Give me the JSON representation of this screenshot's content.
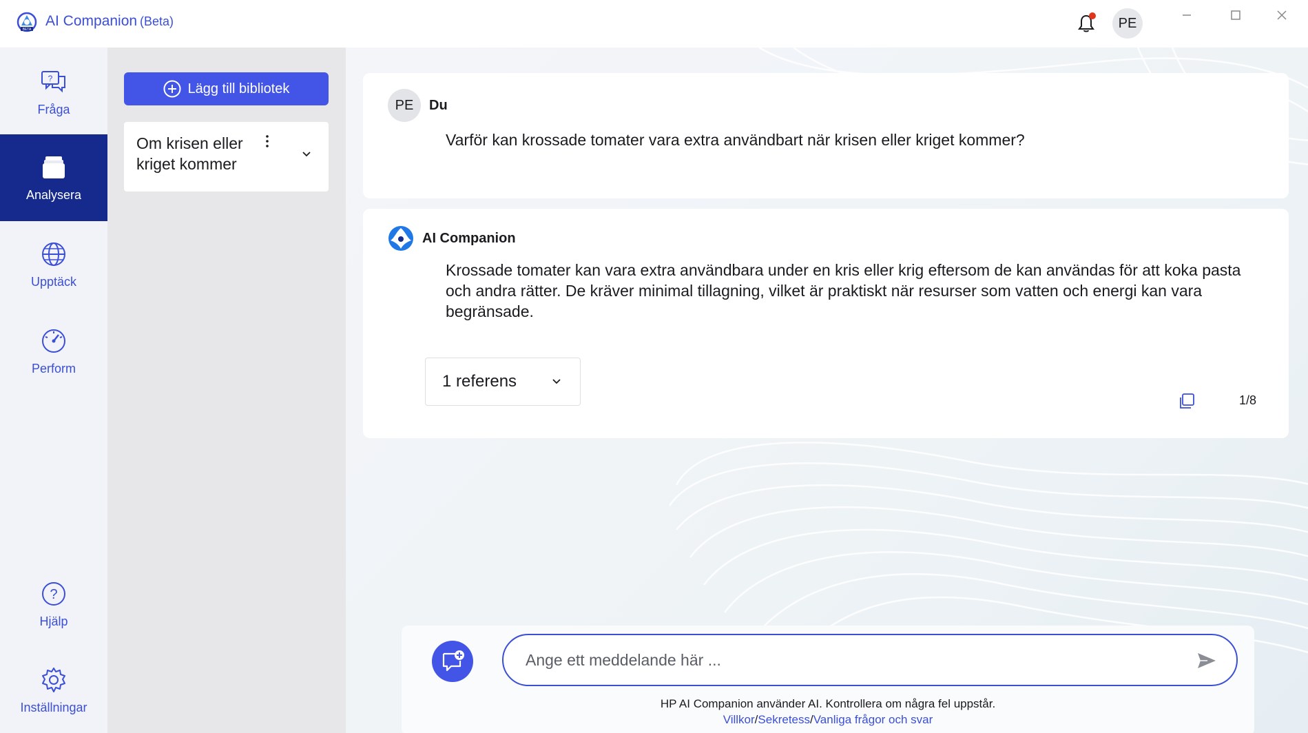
{
  "app": {
    "title": "AI Companion",
    "beta": "(Beta)",
    "logo_badge": "BETA",
    "avatar_initials": "PE",
    "accent": "#3a4fd6",
    "nav_active_bg": "#162a8e"
  },
  "nav": {
    "items": [
      {
        "label": "Fråga",
        "icon": "chat-question-icon"
      },
      {
        "label": "Analysera",
        "icon": "documents-icon"
      },
      {
        "label": "Upptäck",
        "icon": "globe-icon"
      },
      {
        "label": "Perform",
        "icon": "gauge-icon"
      }
    ],
    "bottom_items": [
      {
        "label": "Hjälp",
        "icon": "help-icon"
      },
      {
        "label": "Inställningar",
        "icon": "settings-icon"
      }
    ],
    "active": "Analysera"
  },
  "library": {
    "add_button_label": "Lägg till bibliotek",
    "items": [
      {
        "title": "Om krisen eller kriget kommer"
      }
    ]
  },
  "conversation": {
    "user": {
      "initials": "PE",
      "name": "Du",
      "message": "Varför kan krossade tomater vara extra användbart när krisen eller kriget kommer?"
    },
    "ai": {
      "name": "AI Companion",
      "message": "Krossade tomater kan vara extra användbara under en kris eller krig eftersom de kan användas för att koka pasta och andra rätter. De kräver minimal tillagning, vilket är praktiskt när resurser som vatten och energi kan vara begränsade.",
      "references_label": "1 referens",
      "page_counter": "1/8"
    }
  },
  "composer": {
    "placeholder": "Ange ett meddelande här ...",
    "disclaimer": "HP AI Companion använder AI. Kontrollera om några fel uppstår.",
    "links": {
      "terms": "Villkor",
      "privacy": "Sekretess",
      "faq": "Vanliga frågor och svar",
      "separator": "/"
    }
  }
}
